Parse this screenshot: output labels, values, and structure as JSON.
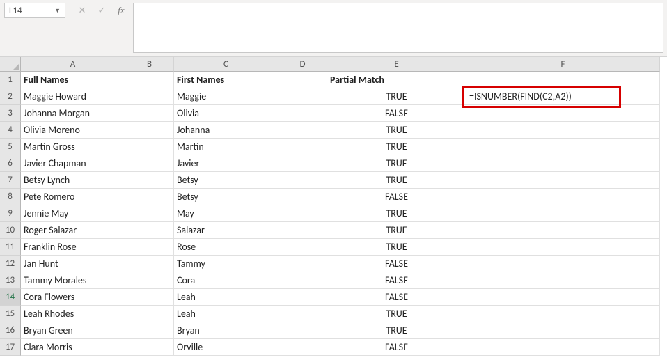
{
  "nameBox": "L14",
  "formulaBar": "",
  "columns": [
    "A",
    "B",
    "C",
    "D",
    "E",
    "F"
  ],
  "headers": {
    "A": "Full Names",
    "C": "First Names",
    "E": "Partial Match"
  },
  "formulaCallout": "=ISNUMBER(FIND(C2,A2))",
  "rows": [
    {
      "n": 1,
      "A": "",
      "C": "",
      "E": ""
    },
    {
      "n": 2,
      "A": "Maggie Howard",
      "C": "Maggie",
      "E": "TRUE"
    },
    {
      "n": 3,
      "A": "Johanna Morgan",
      "C": "Olivia",
      "E": "FALSE"
    },
    {
      "n": 4,
      "A": "Olivia Moreno",
      "C": "Johanna",
      "E": "TRUE"
    },
    {
      "n": 5,
      "A": "Martin Gross",
      "C": "Martin",
      "E": "TRUE"
    },
    {
      "n": 6,
      "A": "Javier Chapman",
      "C": "Javier",
      "E": "TRUE"
    },
    {
      "n": 7,
      "A": "Betsy Lynch",
      "C": "Betsy",
      "E": "TRUE"
    },
    {
      "n": 8,
      "A": "Pete Romero",
      "C": "Betsy",
      "E": "FALSE"
    },
    {
      "n": 9,
      "A": "Jennie May",
      "C": "May",
      "E": "TRUE"
    },
    {
      "n": 10,
      "A": "Roger Salazar",
      "C": "Salazar",
      "E": "TRUE"
    },
    {
      "n": 11,
      "A": "Franklin Rose",
      "C": "Rose",
      "E": "TRUE"
    },
    {
      "n": 12,
      "A": "Jan Hunt",
      "C": "Tammy",
      "E": "FALSE"
    },
    {
      "n": 13,
      "A": "Tammy Morales",
      "C": "Cora",
      "E": "FALSE"
    },
    {
      "n": 14,
      "A": "Cora Flowers",
      "C": "Leah",
      "E": "FALSE"
    },
    {
      "n": 15,
      "A": "Leah Rhodes",
      "C": "Leah",
      "E": "TRUE"
    },
    {
      "n": 16,
      "A": "Bryan Green",
      "C": "Bryan",
      "E": "TRUE"
    },
    {
      "n": 17,
      "A": "Clara Morris",
      "C": "Orville",
      "E": "FALSE"
    }
  ],
  "activeRow": 14,
  "chart_data": {
    "type": "table",
    "title": "Partial Match lookup",
    "columns": [
      "Full Names",
      "First Names",
      "Partial Match"
    ],
    "data": [
      [
        "Maggie Howard",
        "Maggie",
        "TRUE"
      ],
      [
        "Johanna Morgan",
        "Olivia",
        "FALSE"
      ],
      [
        "Olivia Moreno",
        "Johanna",
        "TRUE"
      ],
      [
        "Martin Gross",
        "Martin",
        "TRUE"
      ],
      [
        "Javier Chapman",
        "Javier",
        "TRUE"
      ],
      [
        "Betsy Lynch",
        "Betsy",
        "TRUE"
      ],
      [
        "Pete Romero",
        "Betsy",
        "FALSE"
      ],
      [
        "Jennie May",
        "May",
        "TRUE"
      ],
      [
        "Roger Salazar",
        "Salazar",
        "TRUE"
      ],
      [
        "Franklin Rose",
        "Rose",
        "TRUE"
      ],
      [
        "Jan Hunt",
        "Tammy",
        "FALSE"
      ],
      [
        "Tammy Morales",
        "Cora",
        "FALSE"
      ],
      [
        "Cora Flowers",
        "Leah",
        "FALSE"
      ],
      [
        "Leah Rhodes",
        "Leah",
        "TRUE"
      ],
      [
        "Bryan Green",
        "Bryan",
        "TRUE"
      ],
      [
        "Clara Morris",
        "Orville",
        "FALSE"
      ]
    ],
    "formula": "=ISNUMBER(FIND(C2,A2))"
  }
}
